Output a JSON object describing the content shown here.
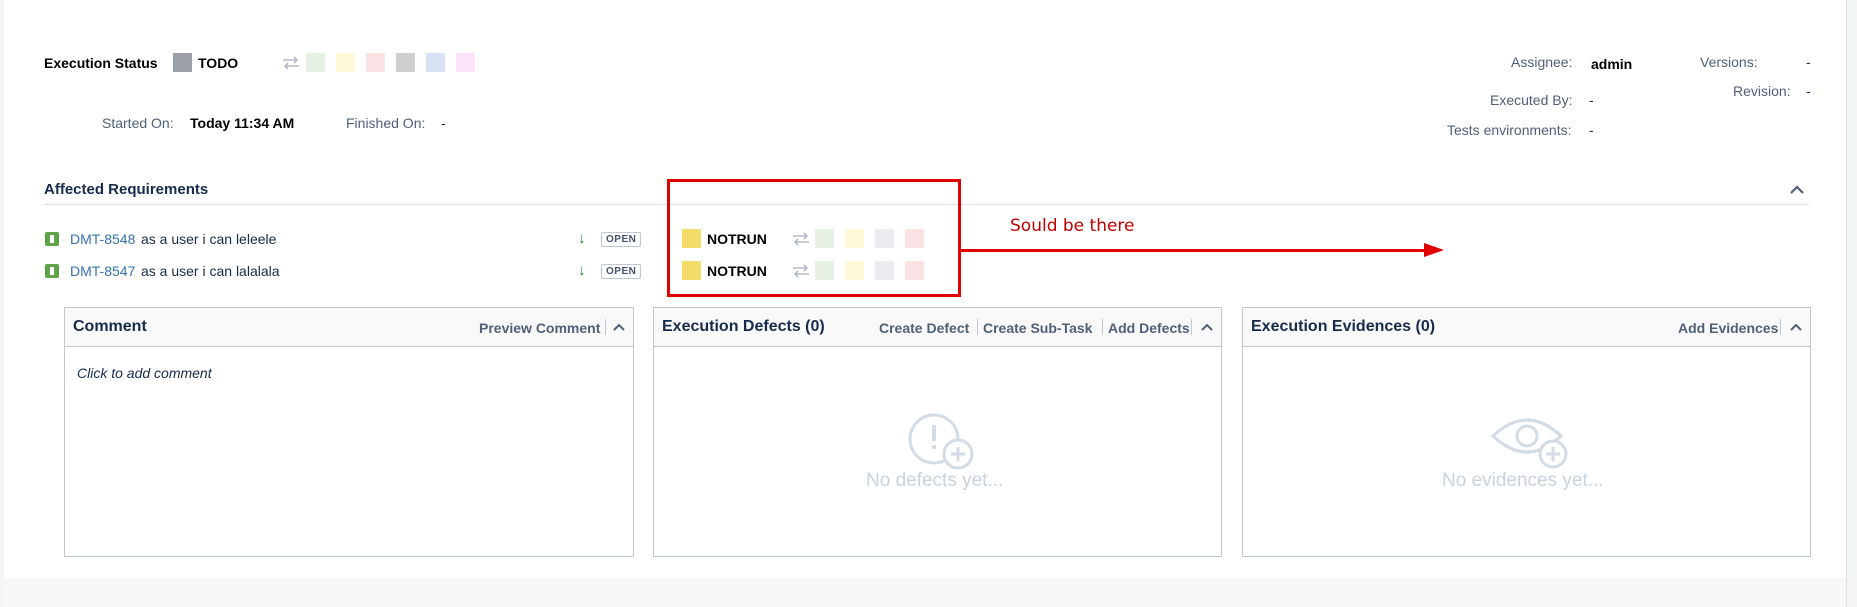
{
  "execution": {
    "status_label": "Execution Status",
    "status_value": "TODO",
    "started_label": "Started On:",
    "started_value": "Today 11:34 AM",
    "finished_label": "Finished On:",
    "finished_value": "-",
    "status_swatches": [
      "#e7f1e3",
      "#fdf8d9",
      "#fbe3e3",
      "#cfcfcf",
      "#d6e3f5",
      "#fbe3fb"
    ]
  },
  "meta": {
    "assignee_label": "Assignee:",
    "assignee_value": "admin",
    "versions_label": "Versions:",
    "versions_value": "-",
    "revision_label": "Revision:",
    "revision_value": "-",
    "executed_by_label": "Executed By:",
    "executed_by_value": "-",
    "tests_env_label": "Tests environments:",
    "tests_env_value": "-"
  },
  "requirements": {
    "title": "Affected Requirements",
    "items": [
      {
        "key": "DMT-8548",
        "summary": "as a user i can leleele",
        "status": "OPEN",
        "exec_status": "NOTRUN"
      },
      {
        "key": "DMT-8547",
        "summary": "as a user i can lalalala",
        "status": "OPEN",
        "exec_status": "NOTRUN"
      }
    ],
    "row_swatches": [
      "#e7f1e3",
      "#fdf8d9",
      "#ebecf0",
      "#fbe3e3"
    ]
  },
  "panels": {
    "comment": {
      "title": "Comment",
      "action": "Preview Comment",
      "placeholder": "Click to add comment"
    },
    "defects": {
      "title": "Execution Defects (0)",
      "actions": [
        "Create Defect",
        "Create Sub-Task",
        "Add Defects"
      ],
      "empty": "No defects yet..."
    },
    "evidences": {
      "title": "Execution Evidences (0)",
      "action": "Add Evidences",
      "empty": "No evidences yet..."
    }
  },
  "annotation": {
    "text": "Sould be there",
    "color": "#e10000"
  },
  "icons": {
    "swap": "swap-arrows-icon",
    "requirement": "requirement-type-icon",
    "priority": "arrow-down-icon",
    "collapse": "chevron-up-icon",
    "defect_empty": "alert-plus-icon",
    "evidence_empty": "eye-plus-icon"
  }
}
